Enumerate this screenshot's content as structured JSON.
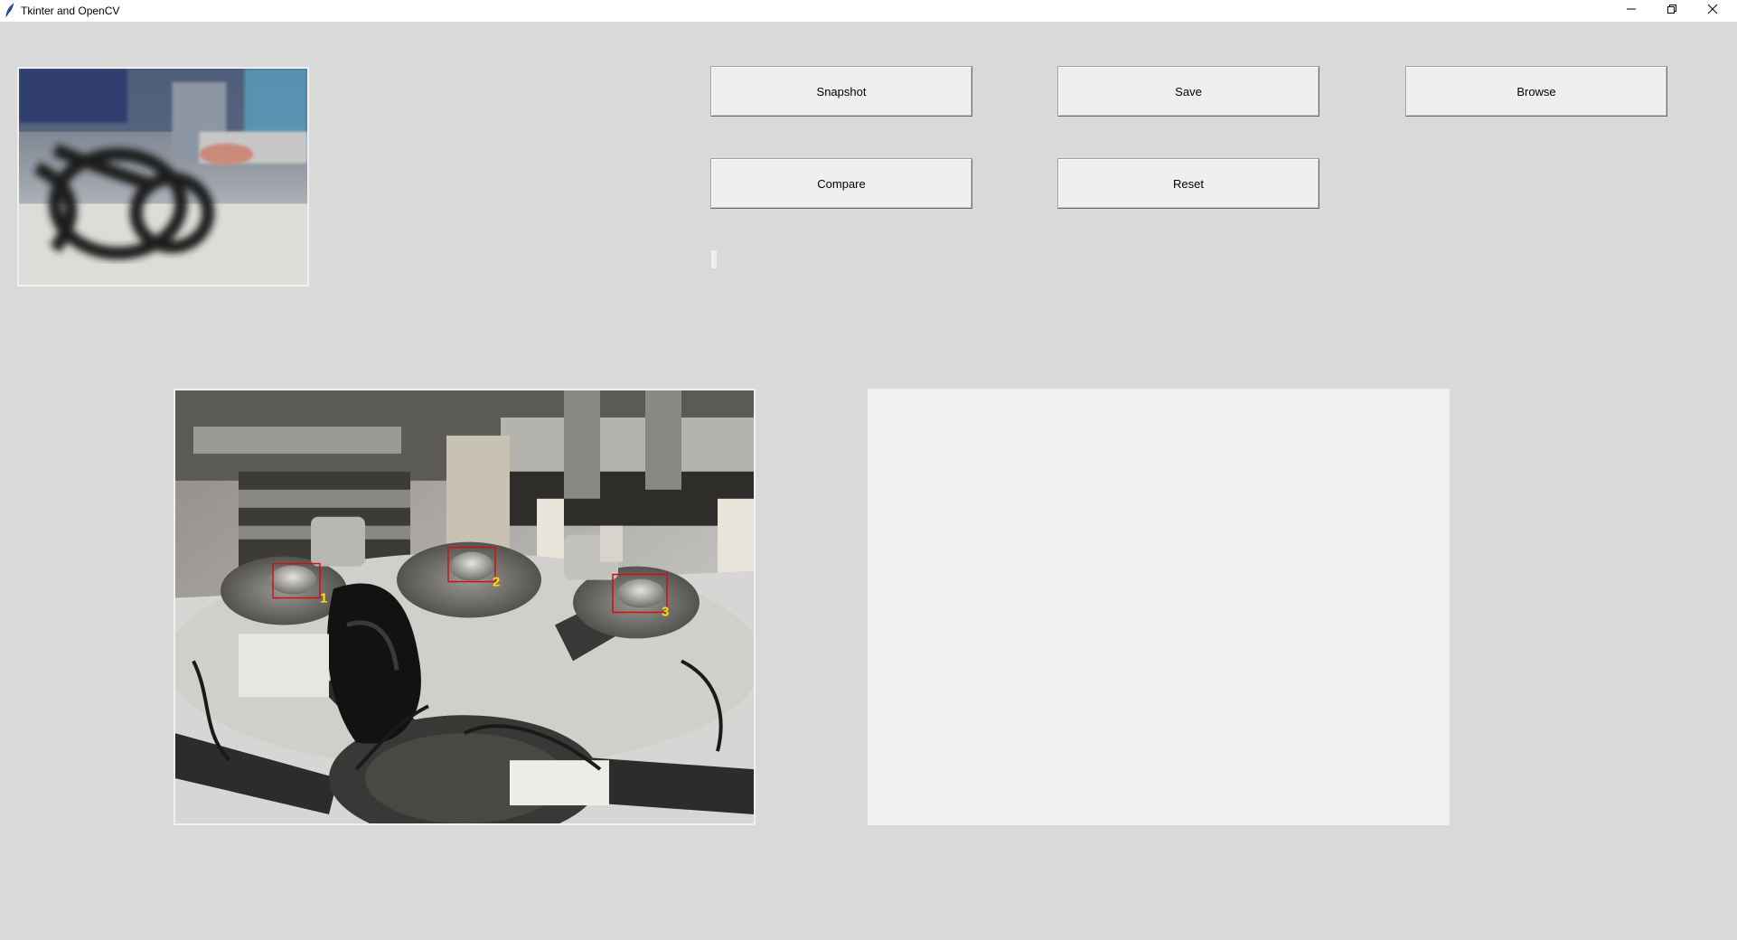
{
  "window": {
    "title": "Tkinter and OpenCV",
    "icons": {
      "app": "feather-icon",
      "minimize": "minimize-icon",
      "maximize": "restore-icon",
      "close": "close-icon"
    }
  },
  "toolbar": {
    "snapshot_label": "Snapshot",
    "save_label": "Save",
    "browse_label": "Browse",
    "compare_label": "Compare",
    "reset_label": "Reset"
  },
  "status": {
    "text": ""
  },
  "main_image": {
    "markers": [
      {
        "label": "1",
        "color": "#ffe000"
      },
      {
        "label": "2",
        "color": "#ffe000"
      },
      {
        "label": "3",
        "color": "#ffe000"
      }
    ],
    "box_color": "#d01010"
  }
}
